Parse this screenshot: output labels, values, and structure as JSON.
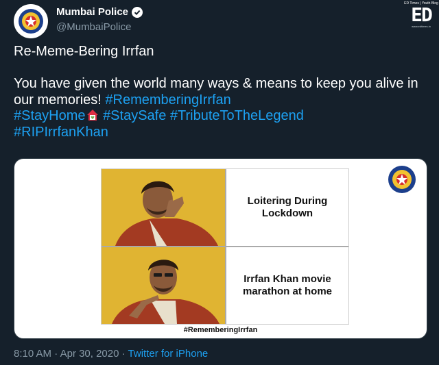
{
  "author": {
    "display_name": "Mumbai Police",
    "handle": "@MumbaiPolice"
  },
  "watermark": {
    "top_text": "ED Times | Youth Blog",
    "logo": "ED",
    "bottom_text": "www.edtimes.in"
  },
  "tweet": {
    "line1": "Re-Meme-Bering Irrfan",
    "body_text": "You have given the world many ways & means to keep you alive in our memories! ",
    "hashtags": {
      "remembering": "#RememberingIrrfan",
      "stayhome": "#StayHome",
      "staysafe": "#StaySafe",
      "tribute": "#TributeToTheLegend",
      "rip": "#RIPIrrfanKhan"
    }
  },
  "meme": {
    "top_caption": "Loitering During Lockdown",
    "bottom_caption": "Irrfan Khan movie marathon at home",
    "hashtag": "#RememberingIrrfan"
  },
  "footer": {
    "time": "8:10 AM",
    "separator": "·",
    "date": "Apr 30, 2020",
    "source": "Twitter for iPhone"
  },
  "colors": {
    "background": "#15202b",
    "link": "#1da1f2",
    "muted": "#8899a6",
    "meme_yellow": "#e0b432"
  },
  "icons": {
    "avatar": "police-emblem",
    "verified": "verified-badge-icon",
    "stay_home": "house-heart-emoji"
  }
}
